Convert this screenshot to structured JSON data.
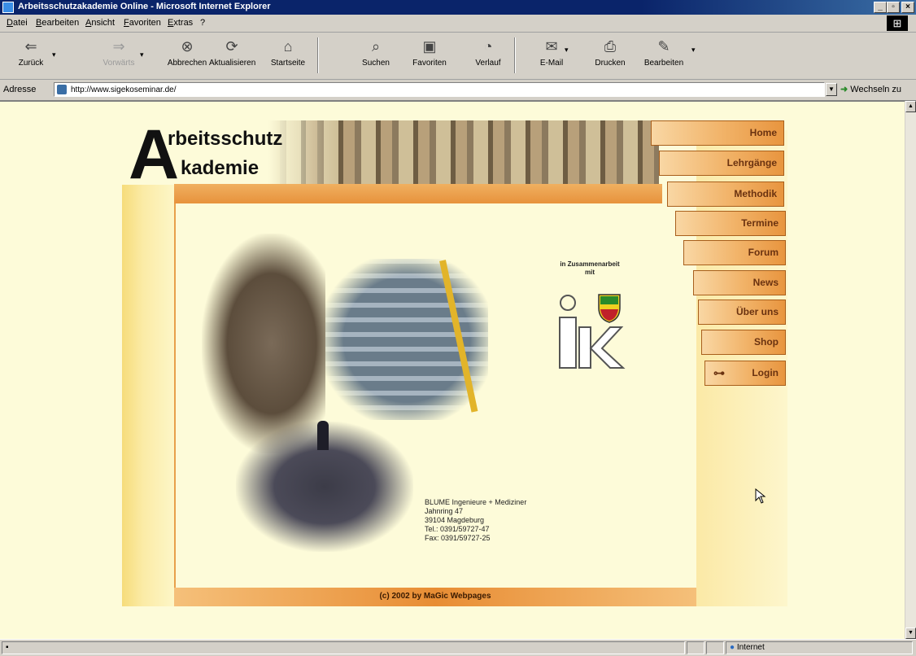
{
  "window": {
    "title": "Arbeitsschutzakademie Online - Microsoft Internet Explorer",
    "buttons": [
      "_",
      "▫",
      "×"
    ]
  },
  "menu": {
    "items": [
      "Datei",
      "Bearbeiten",
      "Ansicht",
      "Favoriten",
      "Extras",
      "?"
    ]
  },
  "toolbar": {
    "buttons": [
      {
        "label": "Zurück",
        "icon": "back-arrow-icon"
      },
      {
        "label": "Vorwärts",
        "icon": "forward-arrow-icon"
      },
      {
        "label": "Abbrechen",
        "icon": "stop-icon"
      },
      {
        "label": "Aktualisieren",
        "icon": "refresh-icon"
      },
      {
        "label": "Startseite",
        "icon": "home-icon"
      },
      {
        "label": "Suchen",
        "icon": "search-icon"
      },
      {
        "label": "Favoriten",
        "icon": "favorites-icon"
      },
      {
        "label": "Verlauf",
        "icon": "history-icon"
      },
      {
        "label": "E-Mail",
        "icon": "mail-icon"
      },
      {
        "label": "Drucken",
        "icon": "print-icon"
      },
      {
        "label": "Bearbeiten",
        "icon": "edit-icon"
      }
    ]
  },
  "address": {
    "label": "Adresse",
    "url": "http://www.sigekoseminar.de/",
    "go_label": "Wechseln zu"
  },
  "page": {
    "logo_letter": "A",
    "logo_line1": "rbeitsschutz",
    "logo_line2": "kademie",
    "nav": [
      {
        "label": "Home"
      },
      {
        "label": "Lehrgänge"
      },
      {
        "label": "Methodik"
      },
      {
        "label": "Termine"
      },
      {
        "label": "Forum"
      },
      {
        "label": "News"
      },
      {
        "label": "Über uns"
      },
      {
        "label": "Shop"
      },
      {
        "label": "Login",
        "icon": "key-icon"
      }
    ],
    "cooperation_line1": "in Zusammenarbeit",
    "cooperation_line2": "mit",
    "partner_logo_text": "ik",
    "contact": {
      "company": "BLUME Ingenieure + Mediziner",
      "street": "Jahnring 47",
      "city": "39104 Magdeburg",
      "phone": "Tel.: 0391/59727-47",
      "fax": "Fax: 0391/59727-25"
    },
    "footer": "(c) 2002 by MaGic Webpages"
  },
  "status": {
    "zone": "Internet"
  },
  "colors": {
    "page_bg": "#fdfbd9",
    "accent_orange": "#e7923c",
    "nav_text": "#6a3210"
  }
}
